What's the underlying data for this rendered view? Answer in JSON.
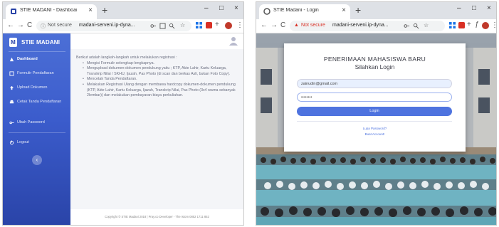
{
  "colors": {
    "sidebar_top": "#4c6fd6",
    "sidebar_bottom": "#2a44a8",
    "primary": "#4e73df",
    "warning": "#d93025"
  },
  "left_window": {
    "tab": {
      "title": "STIE MADANI - Dashboard",
      "close": "×"
    },
    "new_tab": "+",
    "controls": {
      "minimize": "–",
      "maximize": "□",
      "close": "×"
    },
    "nav": {
      "back": "←",
      "forward": "→",
      "reload": "C"
    },
    "address": {
      "security": "Not secure",
      "url": "madani-serveni.ip-dyna..."
    },
    "app": {
      "brand_logo": "M",
      "brand_name": "STIE MADANI",
      "menu": [
        {
          "label": "Dashboard",
          "icon": "dashboard-icon"
        },
        {
          "label": "Formulir Pendaftaran",
          "icon": "form-icon"
        },
        {
          "label": "Upload Dokumen",
          "icon": "upload-icon"
        },
        {
          "label": "Cetak Tanda Pendaftaran",
          "icon": "print-icon"
        },
        {
          "label": "Ubah Password",
          "icon": "key-icon"
        },
        {
          "label": "Logout",
          "icon": "logout-icon"
        }
      ],
      "toggle": "‹",
      "instructions": {
        "intro": "Berikut adalah langkah-langkah untuk melakukan registrasi :",
        "steps": [
          "Mengisi Formulir selengkap-lengkapnya.",
          "Mengupload dokumen-dokumen pendukung yaitu ; KTP, Akte Lahir, Kartu Keluarga, Transkrip Nilai / SKHU, Ijazah, Pas Photo (di scan dan berkas Asli, bukan Foto Copy).",
          "Mencetak Tanda Pendaftaran.",
          "Melakukan Registrasi Ulang dengan membawa hardcopy dokumen-dokumen pendukung (KTP, Akte Lahir, Kartu Keluarga, Ijazah, Transkrip Nilai, Pas Photo (3x4 warna sebanyak 2lembar)) dan melakukan pembayaran biaya perkuliahan."
        ]
      },
      "footer": "Copyright © STIE Madani 2018 | Pray.co Developer - The Istom 0852 1711 852"
    }
  },
  "right_window": {
    "tab": {
      "title": "STIE Madani - Login",
      "close": "×"
    },
    "new_tab": "+",
    "controls": {
      "minimize": "–",
      "maximize": "□",
      "close": "×"
    },
    "nav": {
      "back": "←",
      "forward": "→",
      "reload": "C"
    },
    "address": {
      "security": "Not secure",
      "url": "madani-serveni.ip-dyna..."
    },
    "login": {
      "title": "PENERIMAAN MAHASISWA BARU",
      "subtitle": "Silahkan Login",
      "email": "zainudin@gmail.com",
      "password": "••••••••",
      "button": "Login",
      "forgot": "Lupa Password?",
      "reset": "Buat Account!"
    }
  }
}
